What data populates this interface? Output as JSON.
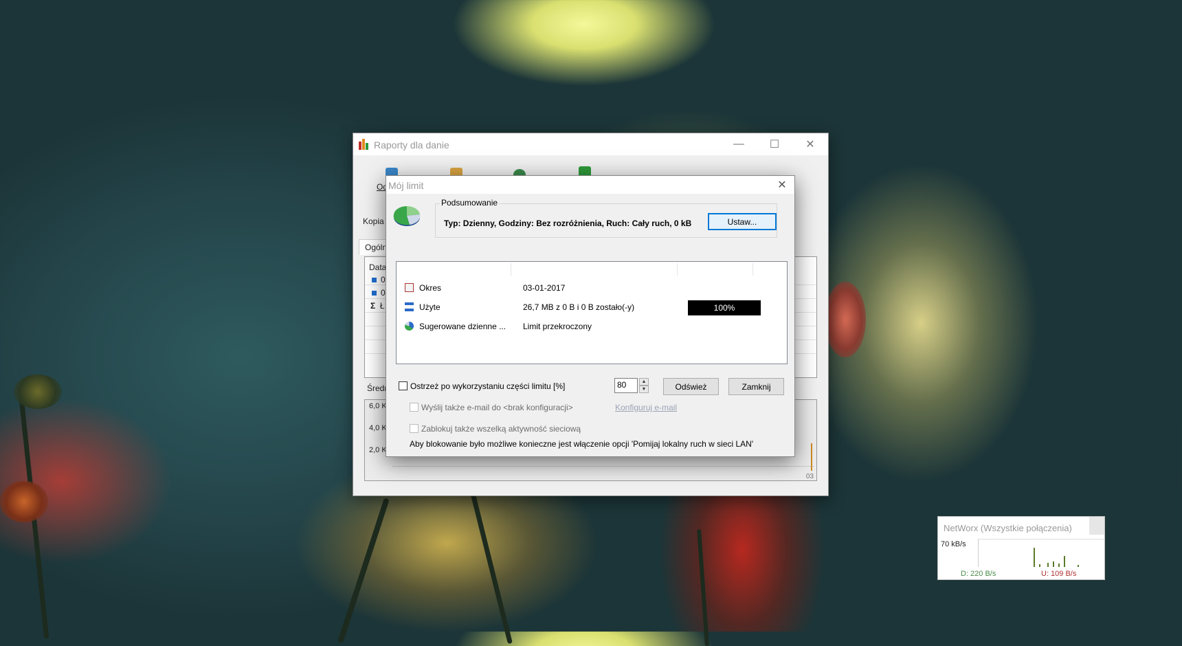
{
  "main_window": {
    "title": "Raporty dla danie",
    "toolbar_partial": "Od",
    "copy_partial": "Kopia z",
    "tab_partial": "Ogólni",
    "table_header_partial": "Data",
    "row1_partial": "0",
    "row2_partial": "0",
    "sum_symbol": "Σ",
    "sum_partial": "Ł",
    "avg_partial": "Średn",
    "chart_ticks": [
      "6,0 K",
      "4,0 K",
      "2,0 K"
    ],
    "chart_last_label": "03",
    "caption_minimize": "—",
    "caption_maximize": "☐",
    "caption_close": "✕"
  },
  "dialog": {
    "title": "Mój limit",
    "close": "✕",
    "summary_group_label": "Podsumowanie",
    "summary_text": "Typ: Dzienny, Godziny: Bez rozróżnienia, Ruch: Cały ruch, 0 kB",
    "set_button": "Ustaw...",
    "rows": [
      {
        "name": "Okres",
        "value": "03-01-2017"
      },
      {
        "name": "Użyte",
        "value": "26,7 MB z 0 B i 0 B zostało(-y)",
        "progress_label": "100%",
        "progress": 1.0
      },
      {
        "name": "Sugerowane dzienne ...",
        "value": "Limit przekroczony"
      }
    ],
    "warn_checkbox_label": "Ostrzeż po wykorzystaniu części limitu [%]",
    "warn_checked": false,
    "percent_value": "80",
    "refresh_button": "Odśwież",
    "close_button": "Zamknij",
    "email_checkbox_label": "Wyślij także e-mail do <brak konfiguracji>",
    "configure_email_link": "Konfiguruj e-mail",
    "block_checkbox_label": "Zablokuj także wszelką aktywność sieciową",
    "block_note": "Aby blokowanie było możliwe konieczne jest włączenie opcji 'Pomijaj lokalny ruch w sieci LAN'"
  },
  "widget": {
    "title": "NetWorx (Wszystkie połączenia)",
    "scale": "70 kB/s",
    "download": "D: 220 B/s",
    "upload": "U: 109 B/s",
    "colors": {
      "download": "#4a8a4a",
      "upload": "#b03030"
    }
  },
  "icons": {
    "app": "bar-chart-icon",
    "okres": "calendar-icon",
    "uzyte": "hourglass-icon",
    "sugerowane": "pie-icon"
  }
}
